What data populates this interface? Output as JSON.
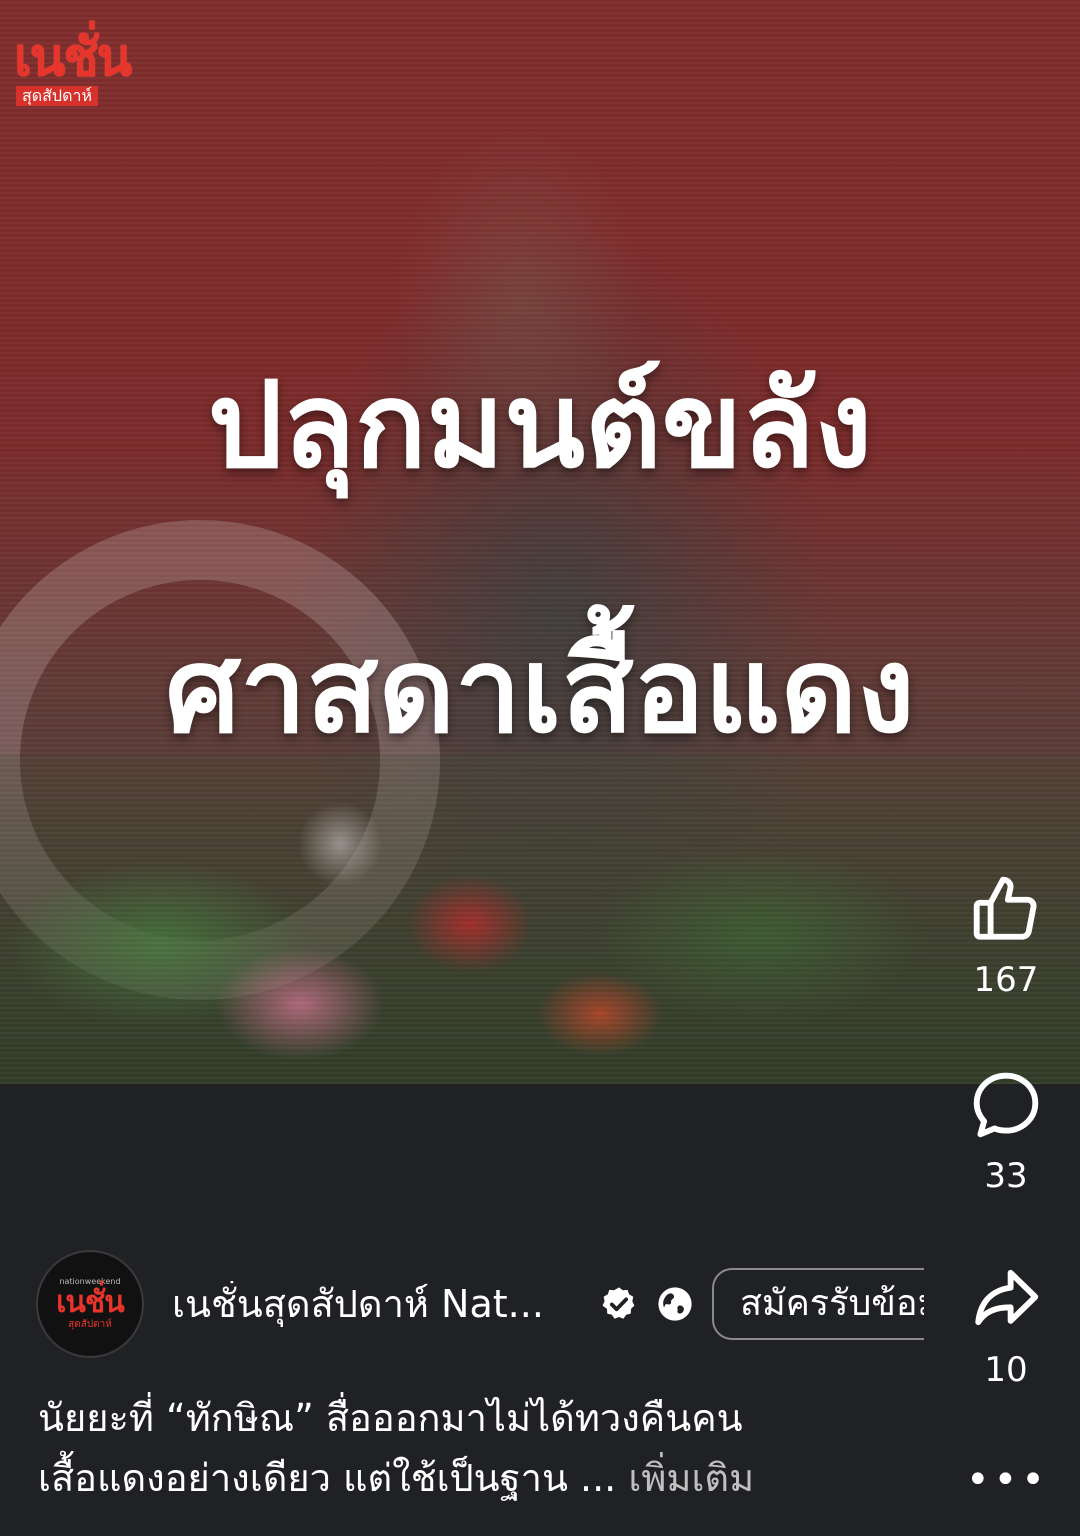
{
  "video": {
    "logo_main": "เนชั่น",
    "logo_sub": "สุดสัปดาห์",
    "headline_line1": "ปลุกมนต์ขลัง",
    "headline_line2": "ศาสดาเสื้อแดง"
  },
  "actions": {
    "like_count": "167",
    "comment_count": "33",
    "share_count": "10",
    "more_label": "•••"
  },
  "author": {
    "avatar_top": "nationweekend",
    "avatar_main": "เนชั่น",
    "avatar_sub": "สุดสัปดาห์",
    "name": "เนชั่นสุดสัปดาห์ Nat...",
    "subscribe_label": "สมัครรับข้อมูล"
  },
  "caption": {
    "line1": "นัยยะที่ “ทักษิณ” สื่อออกมาไม่ได้ทวงคืนคน",
    "line2": "เสื้อแดงอย่างเดียว แต่ใช้เป็นฐาน ...",
    "more": "เพิ่มเติม"
  },
  "colors": {
    "brand_red": "#e8352c",
    "background": "#202124"
  }
}
